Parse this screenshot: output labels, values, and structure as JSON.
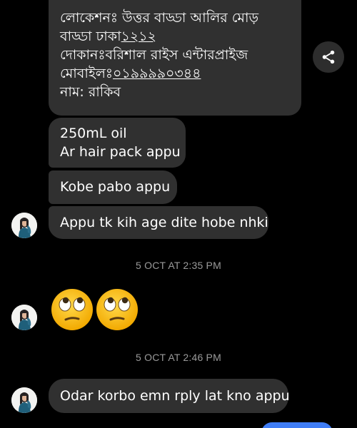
{
  "messages": {
    "location_card": {
      "lines": [
        {
          "text": "লোকেশনঃ উত্তর বাড্ডা আলির মোড়"
        },
        {
          "prefix": "বাড্ডা ঢাকা",
          "underlined": "১২১২"
        },
        {
          "text": "দোকানঃবরিশাল রাইস এন্টারপ্রাইজ"
        },
        {
          "prefix": "মোবাইলঃ",
          "underlined": "০১৯৯৯৯০৩৪৪"
        },
        {
          "text": "নাম: রাকিব"
        }
      ]
    },
    "oil_message": {
      "line1": "250mL oil",
      "line2": "Ar hair pack appu"
    },
    "kobe_message": "Kobe pabo appu",
    "appu_message": "Appu tk kih age dite hobe nhki",
    "odar_message": "Odar korbo emn rply lat kno appu"
  },
  "timestamps": {
    "first": "5 OCT AT 2:35 PM",
    "second": "5 OCT AT 2:46 PM"
  },
  "icons": {
    "share": "share-icon",
    "reaction_emoji": "face-with-rolling-eyes"
  },
  "colors": {
    "background": "#000000",
    "bubble": "#303030",
    "timestamp": "#9a9a9a",
    "sent_bubble": "#3f7df6",
    "emoji": "#f5c518"
  }
}
